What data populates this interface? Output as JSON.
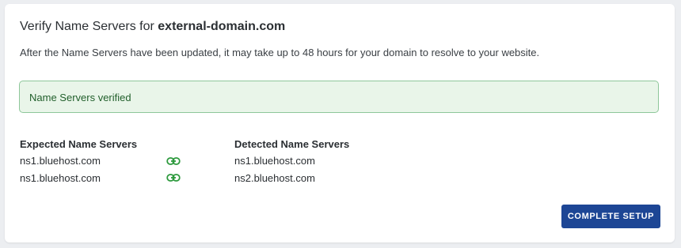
{
  "header": {
    "title_prefix": "Verify Name Servers for ",
    "domain": "external-domain.com",
    "description": "After the Name Servers have been updated, it may take up to 48 hours for your domain to resolve to your website."
  },
  "alert": {
    "text": "Name Servers verified",
    "status_color": "#215f2b"
  },
  "table": {
    "expected_header": "Expected Name Servers",
    "detected_header": "Detected Name Servers",
    "rows": [
      {
        "expected": "ns1.bluehost.com",
        "icon": "link-icon",
        "detected": "ns1.bluehost.com"
      },
      {
        "expected": "ns1.bluehost.com",
        "icon": "link-icon",
        "detected": "ns2.bluehost.com"
      }
    ]
  },
  "actions": {
    "complete_label": "COMPLETE SETUP",
    "accent_color": "#1d4695"
  }
}
